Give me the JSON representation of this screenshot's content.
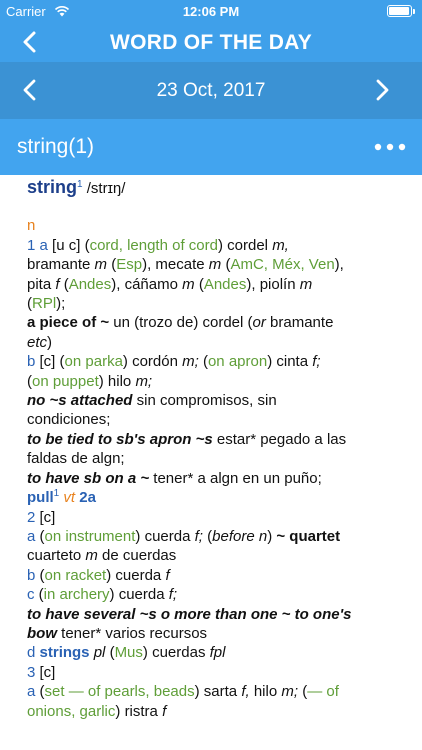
{
  "status": {
    "carrier": "Carrier",
    "time": "12:06 PM",
    "battery_level": 0.85
  },
  "nav": {
    "title": "WORD OF THE DAY"
  },
  "date_bar": {
    "date": "23 Oct, 2017"
  },
  "entry": {
    "header_title": "string(1)",
    "headword": "string",
    "headword_sup": "1",
    "pronunciation": "/strɪŋ/",
    "pos_n": "n",
    "s1_num": "1",
    "s1_letter_a": "a",
    "s1_grammar": "[u c]",
    "s1_paren_open": "(",
    "s1_gloss": "cord, length of cord",
    "s1_paren_close": ")",
    "s1_t1": "cordel",
    "s1_m1": "m,",
    "s1_t2": "bramante",
    "s1_m2": "m",
    "s1_esp": "Esp",
    "s1_t3": "mecate",
    "s1_m3": "m",
    "s1_amc": "AmC, Méx, Ven",
    "s1_t4": "pita",
    "s1_f4": "f",
    "s1_andes1": "Andes",
    "s1_t5": "cáñamo",
    "s1_m5": "m",
    "s1_andes2": "Andes",
    "s1_t6": "piolín",
    "s1_m6": "m",
    "s1_rpl": "RPl",
    "phr1_bold": "a piece of ~",
    "phr1_rest": " un (trozo de) cordel (",
    "phr1_or": "or",
    "phr1_rest2": " bramante",
    "phr1_etc": "etc",
    "phr1_close": ")",
    "s1b_letter": "b",
    "s1b_grammar": "[c]",
    "s1b_gloss1": "on parka",
    "s1b_t1": "cordón",
    "s1b_m1": "m;",
    "s1b_gloss2": "on apron",
    "s1b_t2": "cinta",
    "s1b_f2": "f;",
    "s1b_gloss3": "on puppet",
    "s1b_t3": "hilo",
    "s1b_m3": "m;",
    "phr2_bi": "no ~s attached",
    "phr2_rest": " sin compromisos, sin",
    "phr2_rest2": "condiciones;",
    "phr3_bi": "to be tied to sb's apron ~s",
    "phr3_rest": " estar* pegado a las",
    "phr3_rest2": "faldas de algn;",
    "phr4_bi": "to have sb on a ~",
    "phr4_rest": " tener* a algn en un puño;",
    "xref_word": "pull",
    "xref_sup": "1",
    "xref_vt": "vt",
    "xref_sense": "2a",
    "s2_num": "2",
    "s2_grammar": "[c]",
    "s2a_letter": "a",
    "s2a_gloss": "on instrument",
    "s2a_t1": "cuerda",
    "s2a_f1": "f;",
    "s2a_before": "before n",
    "s2a_bold": "~ quartet",
    "s2a_t2": "cuarteto",
    "s2a_m2": "m",
    "s2a_t3": "de cuerdas",
    "s2b_letter": "b",
    "s2b_gloss": "on racket",
    "s2b_t1": "cuerda",
    "s2b_f1": "f",
    "s2c_letter": "c",
    "s2c_gloss": "in archery",
    "s2c_t1": "cuerda",
    "s2c_f1": "f;",
    "phr5_bi1": "to have several ~s o more than one ~ to one's",
    "phr5_bi2": "bow",
    "phr5_rest": " tener* varios recursos",
    "s2d_letter": "d",
    "s2d_bold": "strings",
    "s2d_pl": "pl",
    "s2d_mus": "Mus",
    "s2d_t1": "cuerdas",
    "s2d_fpl": "fpl",
    "s3_num": "3",
    "s3_grammar": "[c]",
    "s3a_letter": "a",
    "s3a_gloss1": "set — of pearls, beads",
    "s3a_t1": "sarta",
    "s3a_f1": "f,",
    "s3a_t2": "hilo",
    "s3a_m2": "m;",
    "s3a_gloss2": "— of",
    "s3a_gloss3": "onions, garlic",
    "s3a_t3": "ristra",
    "s3a_f3": "f"
  }
}
